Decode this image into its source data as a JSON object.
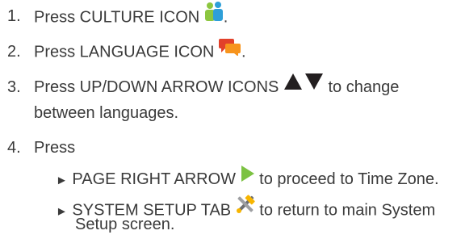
{
  "steps": [
    {
      "num": "1.",
      "pre": "Press CULTURE ICON",
      "post": ".",
      "icon": "culture-icon"
    },
    {
      "num": "2.",
      "pre": "Press LANGUAGE ICON",
      "post": ".",
      "icon": "language-icon"
    },
    {
      "num": "3.",
      "pre": "Press UP/DOWN ARROW ICONS",
      "post": "to change",
      "cont": "between languages.",
      "icon": "up-down-arrow-icons"
    },
    {
      "num": "4.",
      "pre": "Press"
    }
  ],
  "substeps": [
    {
      "bullet": "►",
      "pre": "PAGE RIGHT ARROW",
      "post": "to proceed to Time Zone.",
      "icon": "page-right-arrow-icon"
    },
    {
      "bullet": "►",
      "pre": "SYSTEM SETUP TAB",
      "post": "to return to main System",
      "cont": "Setup screen.",
      "icon": "system-setup-tab-icon"
    }
  ],
  "colors": {
    "text": "#3a3a3a",
    "culture_person_green": "#8cc63f",
    "culture_person_blue": "#2e9fd8",
    "language_bubble_red": "#e2412a",
    "language_bubble_orange": "#f7941d",
    "arrow_black": "#231f20",
    "page_right_arrow_green": "#7cc242"
  }
}
